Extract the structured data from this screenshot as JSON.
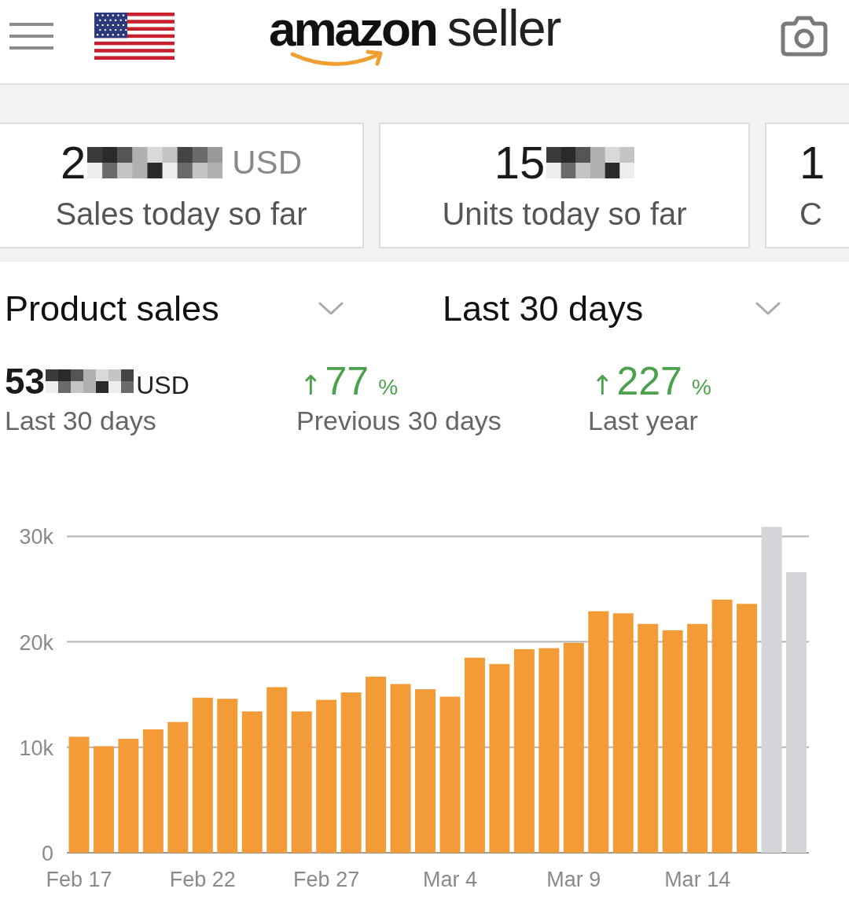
{
  "header": {
    "logo": {
      "brand": "amazon",
      "product": "seller"
    }
  },
  "summary_cards": [
    {
      "value": "2",
      "redacted": true,
      "unit": "USD",
      "label": "Sales today so far"
    },
    {
      "value": "15",
      "redacted": true,
      "label": "Units today so far"
    },
    {
      "value": "1",
      "redacted": false,
      "label": "C"
    }
  ],
  "filters": [
    {
      "label": "Product sales"
    },
    {
      "label": "Last 30 days"
    }
  ],
  "metrics": [
    {
      "kind": "amount",
      "value": "53",
      "redacted": true,
      "unit": "USD",
      "label": "Last 30 days"
    },
    {
      "kind": "change",
      "arrow": "↑",
      "value": "77",
      "unit": "%",
      "label": "Previous 30 days"
    },
    {
      "kind": "change",
      "arrow": "↑",
      "value": "227",
      "unit": "%",
      "label": "Last year"
    }
  ],
  "chart": {
    "chart_data": {
      "type": "bar",
      "stacked": true,
      "grid": true,
      "categories": [
        "Feb 17",
        null,
        null,
        null,
        null,
        "Feb 22",
        null,
        null,
        null,
        null,
        "Feb 27",
        null,
        null,
        null,
        null,
        "Mar 4",
        null,
        null,
        null,
        null,
        "Mar 9",
        null,
        null,
        null,
        null,
        "Mar 14",
        null,
        null,
        null,
        null
      ],
      "ylim": [
        0,
        31000
      ],
      "yticks": [
        {
          "value": 0,
          "label": "0"
        },
        {
          "value": 10000,
          "label": "10k"
        },
        {
          "value": 20000,
          "label": "20k"
        },
        {
          "value": 30000,
          "label": "30k"
        }
      ],
      "series": [
        {
          "color": "#f39b36",
          "values": [
            11000,
            10100,
            10800,
            11700,
            12400,
            14700,
            14600,
            13400,
            15700,
            13400,
            14500,
            15200,
            16700,
            16000,
            15500,
            14800,
            18500,
            17900,
            19300,
            19400,
            19900,
            22900,
            22700,
            21700,
            21100,
            21700,
            24000,
            23600,
            null,
            null
          ]
        },
        {
          "color": "#d3d5d8",
          "values": [
            null,
            null,
            null,
            null,
            null,
            null,
            null,
            null,
            null,
            null,
            null,
            null,
            null,
            null,
            null,
            null,
            null,
            null,
            null,
            null,
            null,
            null,
            null,
            null,
            null,
            null,
            null,
            null,
            30900,
            26600
          ]
        }
      ]
    }
  }
}
